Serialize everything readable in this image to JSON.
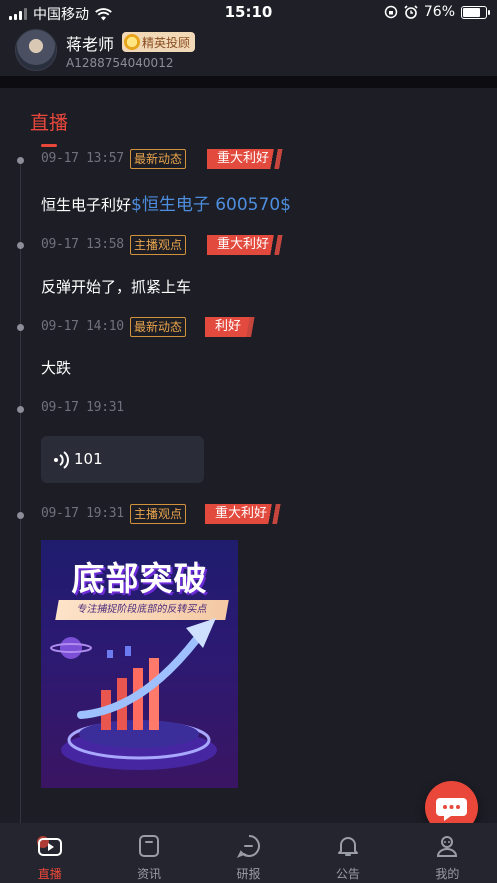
{
  "status_bar": {
    "carrier": "中国移动",
    "time": "15:10",
    "battery": "76%",
    "battery_level": 0.76
  },
  "header": {
    "teacher_name": "蒋老师",
    "badge": "精英投顾",
    "account_id": "A1288754040012"
  },
  "section": {
    "title": "直播"
  },
  "entries": [
    {
      "time": "09-17 13:57",
      "tag": "最新动态",
      "impact": "重大利好",
      "text": "恒生电子利好",
      "stock_link": "$恒生电子 600570$"
    },
    {
      "time": "09-17 13:58",
      "tag": "主播观点",
      "impact": "重大利好",
      "text": "反弹开始了，抓紧上车"
    },
    {
      "time": "09-17 14:10",
      "tag": "最新动态",
      "impact": "利好",
      "text": "大跌"
    },
    {
      "time": "09-17 19:31",
      "audio_duration": "101"
    },
    {
      "time": "09-17 19:31",
      "tag": "主播观点",
      "impact": "重大利好",
      "poster": {
        "title": "底部突破",
        "subtitle": "专注捕捉阶段底部的反转买点"
      }
    }
  ],
  "tabs": [
    {
      "label": "直播",
      "icon": "live-icon",
      "active": true
    },
    {
      "label": "资讯",
      "icon": "news-icon"
    },
    {
      "label": "研报",
      "icon": "report-icon"
    },
    {
      "label": "公告",
      "icon": "bell-icon"
    },
    {
      "label": "我的",
      "icon": "profile-icon"
    }
  ],
  "colors": {
    "accent": "#e8473a",
    "link": "#4e8ede",
    "tag_outline": "#d1923b",
    "background": "#1c1d25"
  }
}
